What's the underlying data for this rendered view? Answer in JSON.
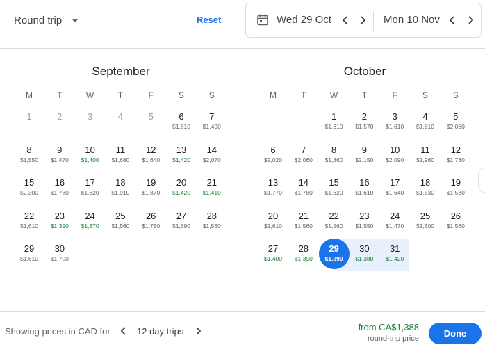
{
  "header": {
    "trip_type": "Round trip",
    "reset_label": "Reset",
    "departure": "Wed 29 Oct",
    "return": "Mon 10 Nov"
  },
  "weekdays": [
    "M",
    "T",
    "W",
    "T",
    "F",
    "S",
    "S"
  ],
  "months": [
    {
      "name": "September",
      "days": [
        {
          "d": "1",
          "p": "",
          "past": true
        },
        {
          "d": "2",
          "p": "",
          "past": true
        },
        {
          "d": "3",
          "p": "",
          "past": true
        },
        {
          "d": "4",
          "p": "",
          "past": true
        },
        {
          "d": "5",
          "p": "",
          "past": true
        },
        {
          "d": "6",
          "p": "$1,610"
        },
        {
          "d": "7",
          "p": "$1,490"
        },
        {
          "d": "8",
          "p": "$1,550"
        },
        {
          "d": "9",
          "p": "$1,470"
        },
        {
          "d": "10",
          "p": "$1,400",
          "low": true
        },
        {
          "d": "11",
          "p": "$1,680"
        },
        {
          "d": "12",
          "p": "$1,640"
        },
        {
          "d": "13",
          "p": "$1,420",
          "low": true
        },
        {
          "d": "14",
          "p": "$2,070"
        },
        {
          "d": "15",
          "p": "$2,300"
        },
        {
          "d": "16",
          "p": "$1,780"
        },
        {
          "d": "17",
          "p": "$1,620"
        },
        {
          "d": "18",
          "p": "$1,910"
        },
        {
          "d": "19",
          "p": "$1,870"
        },
        {
          "d": "20",
          "p": "$1,420",
          "low": true
        },
        {
          "d": "21",
          "p": "$1,410",
          "low": true
        },
        {
          "d": "22",
          "p": "$1,610"
        },
        {
          "d": "23",
          "p": "$1,390",
          "low": true
        },
        {
          "d": "24",
          "p": "$1,370",
          "low": true
        },
        {
          "d": "25",
          "p": "$1,560"
        },
        {
          "d": "26",
          "p": "$1,780"
        },
        {
          "d": "27",
          "p": "$1,590"
        },
        {
          "d": "28",
          "p": "$1,560"
        },
        {
          "d": "29",
          "p": "$1,610"
        },
        {
          "d": "30",
          "p": "$1,700"
        }
      ]
    },
    {
      "name": "October",
      "days": [
        {
          "d": "1",
          "p": "$1,610"
        },
        {
          "d": "2",
          "p": "$1,570"
        },
        {
          "d": "3",
          "p": "$1,610"
        },
        {
          "d": "4",
          "p": "$1,610"
        },
        {
          "d": "5",
          "p": "$2,060"
        },
        {
          "d": "6",
          "p": "$2,020"
        },
        {
          "d": "7",
          "p": "$2,060"
        },
        {
          "d": "8",
          "p": "$1,860"
        },
        {
          "d": "9",
          "p": "$2,150"
        },
        {
          "d": "10",
          "p": "$2,090"
        },
        {
          "d": "11",
          "p": "$1,960"
        },
        {
          "d": "12",
          "p": "$1,780"
        },
        {
          "d": "13",
          "p": "$1,770"
        },
        {
          "d": "14",
          "p": "$1,780"
        },
        {
          "d": "15",
          "p": "$1,620"
        },
        {
          "d": "16",
          "p": "$1,610"
        },
        {
          "d": "17",
          "p": "$1,640"
        },
        {
          "d": "18",
          "p": "$1,530"
        },
        {
          "d": "19",
          "p": "$1,530"
        },
        {
          "d": "20",
          "p": "$1,610"
        },
        {
          "d": "21",
          "p": "$1,560"
        },
        {
          "d": "22",
          "p": "$1,560"
        },
        {
          "d": "23",
          "p": "$1,550"
        },
        {
          "d": "24",
          "p": "$1,470"
        },
        {
          "d": "25",
          "p": "$1,600"
        },
        {
          "d": "26",
          "p": "$1,560"
        },
        {
          "d": "27",
          "p": "$1,400",
          "low": true
        },
        {
          "d": "28",
          "p": "$1,390",
          "low": true
        },
        {
          "d": "29",
          "p": "$1,390",
          "selected": true
        },
        {
          "d": "30",
          "p": "$1,380",
          "low": true,
          "inrange": true
        },
        {
          "d": "31",
          "p": "$1,420",
          "low": true,
          "inrange": true
        }
      ]
    }
  ],
  "footer": {
    "showing": "Showing prices in CAD for",
    "trip_length": "12 day trips",
    "from_price": "from CA$1,388",
    "round_trip_label": "round-trip price",
    "done_label": "Done"
  },
  "colors": {
    "accent": "#1a73e8",
    "low_price": "#188038",
    "range_fill": "#e8f0fe"
  },
  "icons": [
    "calendar-icon",
    "chevron-left-icon",
    "chevron-right-icon",
    "chevron-down-icon"
  ]
}
